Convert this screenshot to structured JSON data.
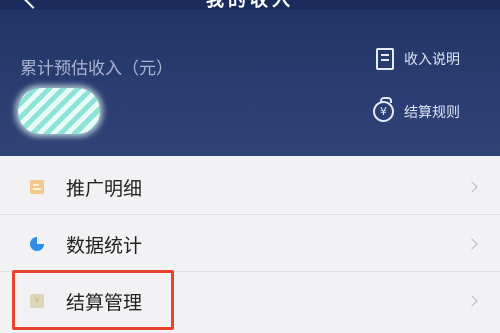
{
  "topbar": {
    "title": "我的收入"
  },
  "header": {
    "cumulative_label": "累计预估收入（元）",
    "links": {
      "income_info": "收入说明",
      "settlement_rules": "结算规则"
    }
  },
  "menu": {
    "items": [
      {
        "label": "推广明细",
        "icon": "document-list-icon"
      },
      {
        "label": "数据统计",
        "icon": "pie-chart-icon"
      },
      {
        "label": "结算管理",
        "icon": "yen-note-icon"
      }
    ]
  },
  "colors": {
    "header_bg": "#213466",
    "highlight": "#e8432e",
    "stats_icon": "#2e8ee8",
    "promo_icon": "#f2c98a"
  }
}
